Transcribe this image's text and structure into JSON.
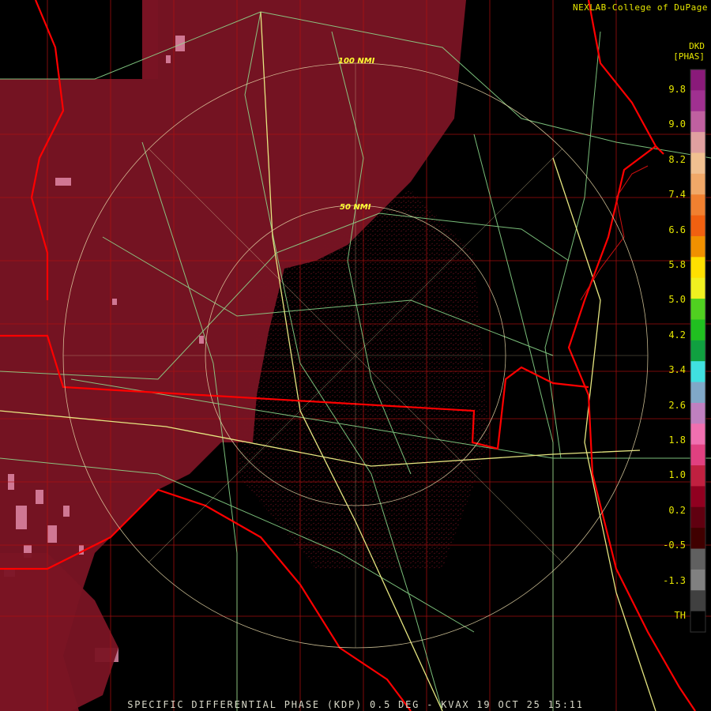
{
  "credit": "NEXLAB-College of DuPage",
  "product_code": "DKD",
  "product_units": "[PHAS]",
  "caption": "SPECIFIC DIFFERENTIAL PHASE (KDP) 0.5 DEG - KVAX 19 OCT 25 15:11",
  "range_rings": [
    "100 NMI",
    "50 NMI"
  ],
  "colorbar": {
    "labels": [
      "9.8",
      "9.0",
      "8.2",
      "7.4",
      "6.6",
      "5.8",
      "5.0",
      "4.2",
      "3.4",
      "2.6",
      "1.8",
      "1.0",
      "0.2",
      "-0.5",
      "-1.3",
      "TH"
    ],
    "colors": [
      "#8a1a7a",
      "#a03090",
      "#c060a0",
      "#e0a0a0",
      "#f0c090",
      "#f0a868",
      "#f08030",
      "#f06010",
      "#f09000",
      "#ffe000",
      "#f0f020",
      "#50d020",
      "#20c020",
      "#10a040",
      "#40e0e0",
      "#80a8c8",
      "#c080c0",
      "#f070b0",
      "#e04080",
      "#c02040",
      "#900020",
      "#600010",
      "#400000",
      "#606060",
      "#808080",
      "#404040",
      "#000000"
    ]
  },
  "colors": {
    "state_border": "#ff0000",
    "county_border": "#b01010",
    "highway": "#90e090",
    "interstate": "#e6e680",
    "range_ring": "#e8d8a8",
    "echo_fill": "#7a1424"
  }
}
